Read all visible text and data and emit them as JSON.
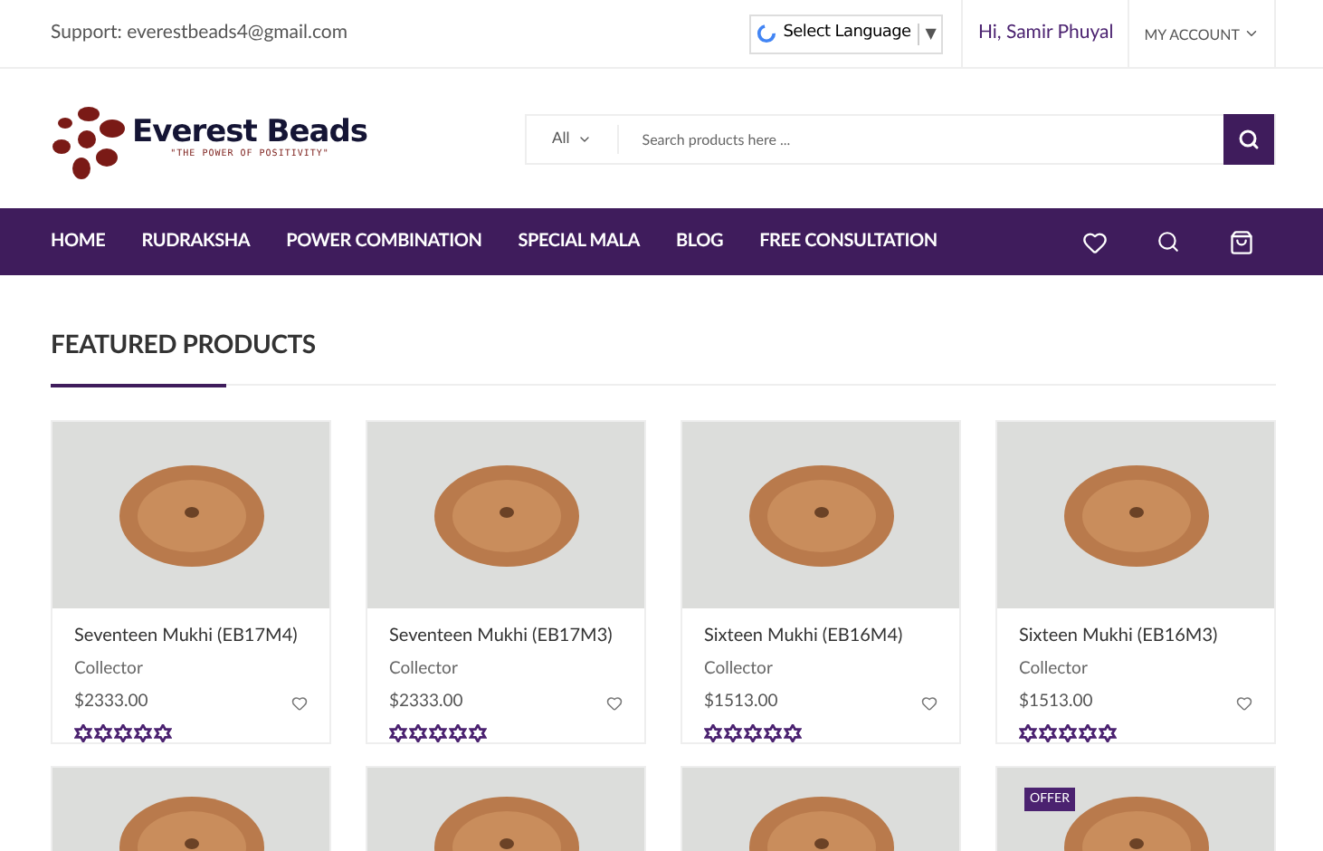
{
  "top_bar": {
    "support": "Support: everestbeads4@gmail.com",
    "language": "Select Language",
    "language_caret": "▼",
    "greeting": "Hi, Samir Phuyal",
    "account": "MY ACCOUNT"
  },
  "header": {
    "logo_name": "Everest Beads",
    "logo_tagline": "\"THE POWER OF POSITIVITY\"",
    "category": "All",
    "search": {
      "placeholder": "Search products here ..."
    }
  },
  "nav": {
    "items": [
      {
        "label": "HOME"
      },
      {
        "label": "RUDRAKSHA"
      },
      {
        "label": "POWER COMBINATION"
      },
      {
        "label": "SPECIAL MALA"
      },
      {
        "label": "BLOG"
      },
      {
        "label": "FREE CONSULTATION"
      }
    ]
  },
  "section": {
    "title": "FEATURED PRODUCTS"
  },
  "products": [
    {
      "name": "Seventeen Mukhi (EB17M4)",
      "category": "Collector",
      "price": "$2333.00",
      "stars": 0
    },
    {
      "name": "Seventeen Mukhi (EB17M3)",
      "category": "Collector",
      "price": "$2333.00",
      "stars": 0
    },
    {
      "name": "Sixteen Mukhi (EB16M4)",
      "category": "Collector",
      "price": "$1513.00",
      "stars": 0
    },
    {
      "name": "Sixteen Mukhi (EB16M3)",
      "category": "Collector",
      "price": "$1513.00",
      "stars": 0
    }
  ],
  "products_row_2": [
    {
      "offer": false
    },
    {
      "offer": false
    },
    {
      "offer": false
    },
    {
      "offer": true,
      "badge": "OFFER"
    }
  ]
}
